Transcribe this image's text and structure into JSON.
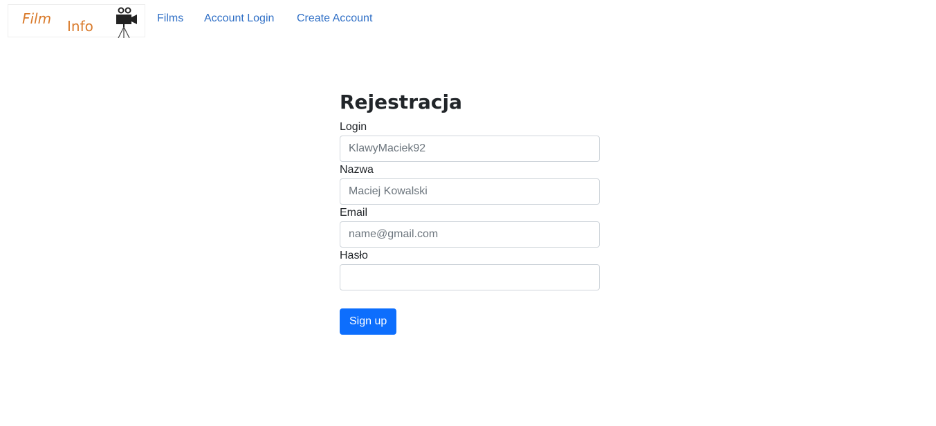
{
  "brand": {
    "word1": "Film",
    "word2": "Info",
    "icon": "film-camera-icon",
    "color": "#d97a2b"
  },
  "nav": {
    "films": "Films",
    "account_login": "Account Login",
    "create_account": "Create Account",
    "link_color": "#2f6fc6"
  },
  "form": {
    "title": "Rejestracja",
    "login": {
      "label": "Login",
      "placeholder": "KlawyMaciek92",
      "value": ""
    },
    "name": {
      "label": "Nazwa",
      "placeholder": "Maciej Kowalski",
      "value": ""
    },
    "email": {
      "label": "Email",
      "placeholder": "name@gmail.com",
      "value": ""
    },
    "password": {
      "label": "Hasło",
      "placeholder": "",
      "value": ""
    },
    "submit": "Sign up",
    "submit_color": "#0d6efd"
  }
}
